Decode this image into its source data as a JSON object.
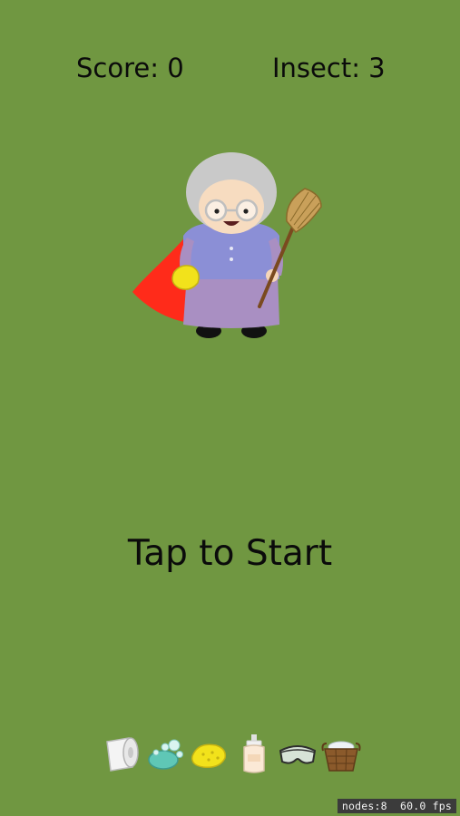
{
  "game": {
    "background_color": "#709741",
    "text_color": "#0b0b0b"
  },
  "hud": {
    "score_text": "Score: 0",
    "insect_text": "Insect: 3"
  },
  "character": {
    "name": "granny-hero",
    "cape_color": "#ff2b1a",
    "top_color": "#8b8fd6",
    "skirt_color": "#a98fc2",
    "hair_color": "#c9c9c9"
  },
  "prompt": {
    "start_text": "Tap to Start"
  },
  "toolbar": {
    "items": [
      {
        "icon": "toilet-paper-icon"
      },
      {
        "icon": "soap-icon"
      },
      {
        "icon": "sponge-icon"
      },
      {
        "icon": "lotion-bottle-icon"
      },
      {
        "icon": "goggles-icon"
      },
      {
        "icon": "laundry-basket-icon"
      }
    ]
  },
  "debug": {
    "nodes": "nodes:8",
    "fps": "60.0 fps"
  }
}
